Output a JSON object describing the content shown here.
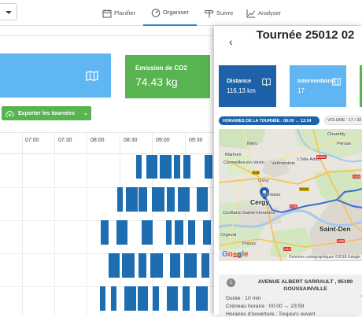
{
  "nav": {
    "items": [
      {
        "label": "Planifier",
        "icon": "calendar-icon",
        "active": false
      },
      {
        "label": "Organiser",
        "icon": "gauge-icon",
        "active": true
      },
      {
        "label": "Suivre",
        "icon": "signpost-icon",
        "active": false
      },
      {
        "label": "Analyser",
        "icon": "chart-icon",
        "active": false
      }
    ]
  },
  "left": {
    "card_blue_icon": "map-icon",
    "emission_label": "Emission de CO2",
    "emission_value": "74.43 kg",
    "export_label": "Exporter les tournées",
    "timeline_ticks": [
      "07:00",
      "07:30",
      "08:00",
      "08:30",
      "09:00",
      "09:30"
    ]
  },
  "panel": {
    "title": "Tournée 25012 02",
    "distance_label": "Distance",
    "distance_value": "116,13 km",
    "interventions_label": "Interventions",
    "interventions_value": "17",
    "hours_label": "HORAIRES DE LA TOURNÉE : 08:00 ↔ 13:34",
    "volume_label": "VOLUME : 17 / 33",
    "map": {
      "labels": [
        "Chambly",
        "Persan",
        "L'Isle-Adam",
        "Méru",
        "Marines",
        "Cormeilles-en-Vexin",
        "Valmondois",
        "Osny",
        "Pontoise",
        "Cergy",
        "Conflans-Sainte-Honorine",
        "Poissy",
        "Saint-Den",
        "Orgeval"
      ],
      "roads": [
        "D301",
        "D915",
        "A15",
        "A16",
        "A14",
        "A13",
        "A86",
        "D28"
      ],
      "copyright": "Données cartographiques ©2018 Google"
    },
    "stop": {
      "number": "1",
      "address": "AVENUE ALBERT SARRAULT , 95190 GOUSSAINVILLE",
      "duration": "Durée : 10 min",
      "window": "Créneau horaire : 00:00 ↔ 23:59",
      "opening": "Horaires d'ouverture : Toujours ouvert",
      "side": "V"
    }
  },
  "colors": {
    "accent_blue": "#1d62a8",
    "light_blue": "#5fb6f2",
    "green": "#57b451",
    "bar_blue": "#1f6db1"
  }
}
